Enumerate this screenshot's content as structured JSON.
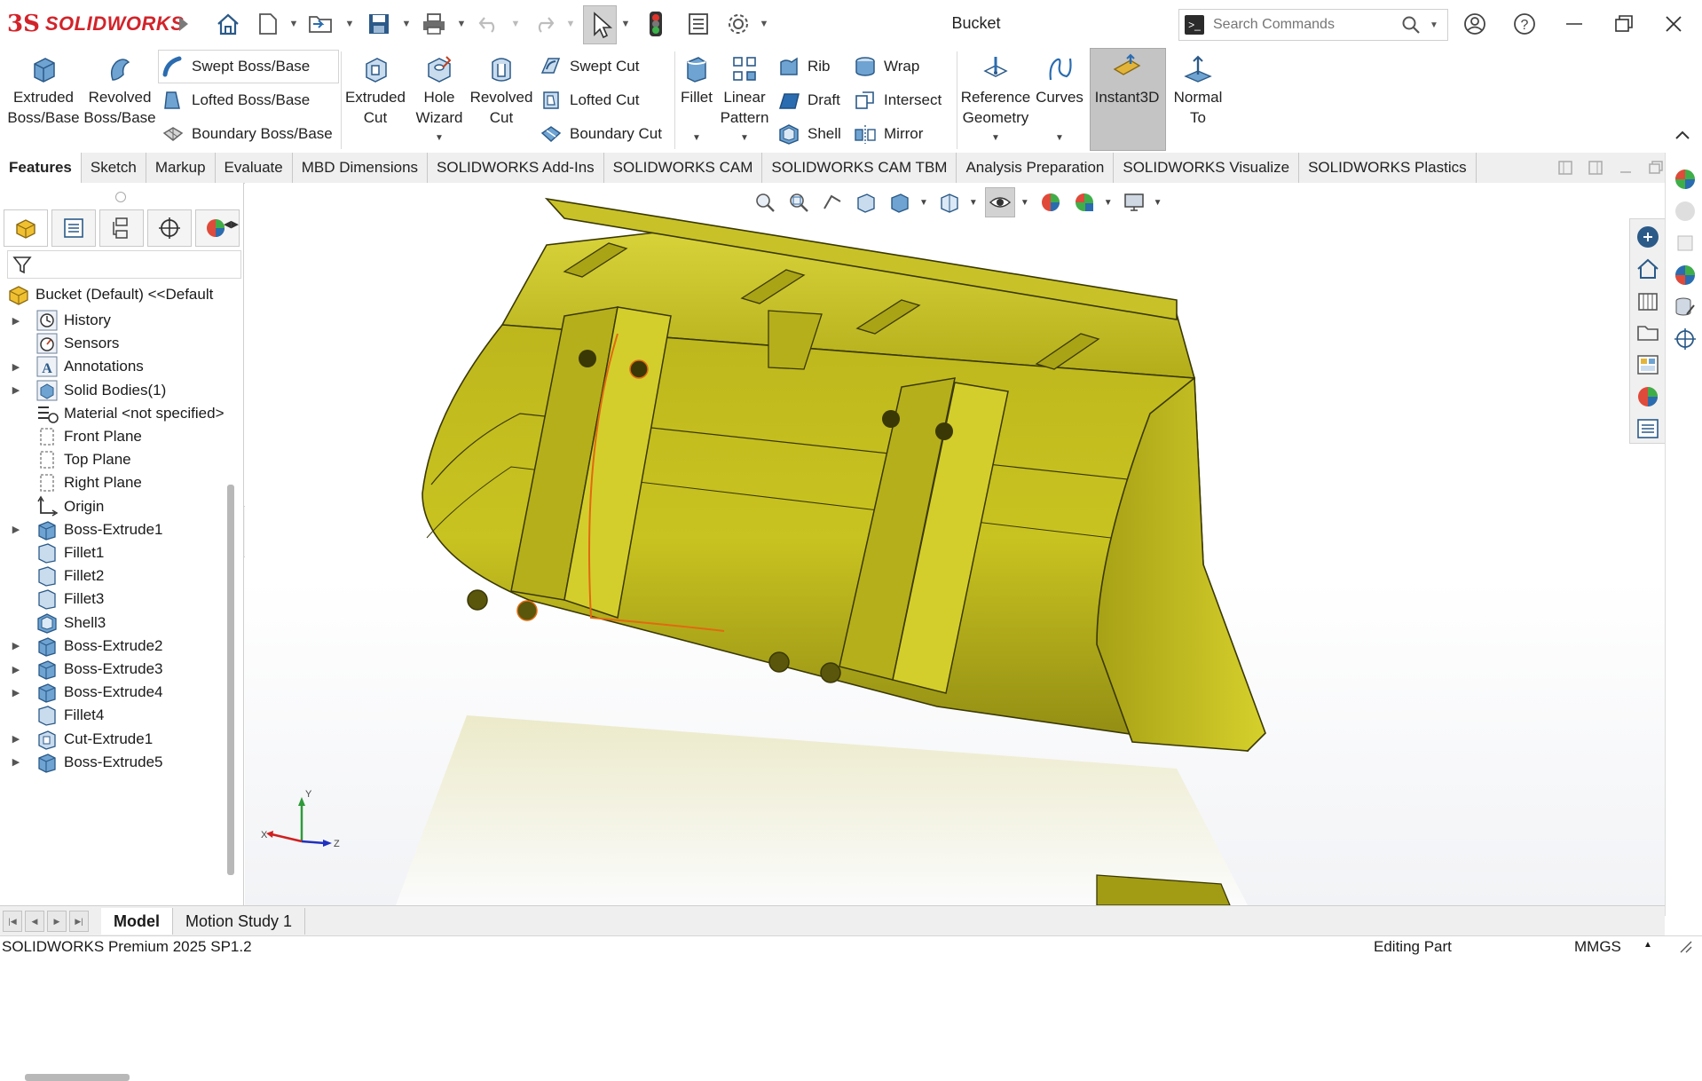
{
  "app": {
    "brand_prefix": "3S",
    "brand": "SOLIDWORKS",
    "doc_title": "Bucket"
  },
  "search": {
    "placeholder": "Search Commands"
  },
  "ribbon": {
    "extruded_boss": [
      "Extruded",
      "Boss/Base"
    ],
    "revolved_boss": [
      "Revolved",
      "Boss/Base"
    ],
    "swept_boss": "Swept Boss/Base",
    "lofted_boss": "Lofted Boss/Base",
    "boundary_boss": "Boundary Boss/Base",
    "extruded_cut": [
      "Extruded",
      "Cut"
    ],
    "hole_wizard": [
      "Hole",
      "Wizard"
    ],
    "revolved_cut": [
      "Revolved",
      "Cut"
    ],
    "swept_cut": "Swept Cut",
    "lofted_cut": "Lofted Cut",
    "boundary_cut": "Boundary Cut",
    "fillet": "Fillet",
    "linear_pattern": [
      "Linear",
      "Pattern"
    ],
    "rib": "Rib",
    "draft": "Draft",
    "shell": "Shell",
    "wrap": "Wrap",
    "intersect": "Intersect",
    "mirror": "Mirror",
    "reference_geometry": [
      "Reference",
      "Geometry"
    ],
    "curves": "Curves",
    "instant3d": "Instant3D",
    "normal_to": [
      "Normal",
      "To"
    ]
  },
  "tabs": [
    "Features",
    "Sketch",
    "Markup",
    "Evaluate",
    "MBD Dimensions",
    "SOLIDWORKS Add-Ins",
    "SOLIDWORKS CAM",
    "SOLIDWORKS CAM TBM",
    "Analysis Preparation",
    "SOLIDWORKS Visualize",
    "SOLIDWORKS Plastics"
  ],
  "tree": {
    "root": "Bucket (Default) <<Default",
    "items": [
      {
        "label": "History",
        "expand": true
      },
      {
        "label": "Sensors",
        "expand": false
      },
      {
        "label": "Annotations",
        "expand": true
      },
      {
        "label": "Solid Bodies(1)",
        "expand": true
      },
      {
        "label": "Material <not specified>",
        "expand": false
      },
      {
        "label": "Front Plane",
        "expand": false
      },
      {
        "label": "Top Plane",
        "expand": false
      },
      {
        "label": "Right Plane",
        "expand": false
      },
      {
        "label": "Origin",
        "expand": false
      },
      {
        "label": "Boss-Extrude1",
        "expand": true
      },
      {
        "label": "Fillet1",
        "expand": false
      },
      {
        "label": "Fillet2",
        "expand": false
      },
      {
        "label": "Fillet3",
        "expand": false
      },
      {
        "label": "Shell3",
        "expand": false
      },
      {
        "label": "Boss-Extrude2",
        "expand": true
      },
      {
        "label": "Boss-Extrude3",
        "expand": true
      },
      {
        "label": "Boss-Extrude4",
        "expand": true
      },
      {
        "label": "Fillet4",
        "expand": false
      },
      {
        "label": "Cut-Extrude1",
        "expand": true
      },
      {
        "label": "Boss-Extrude5",
        "expand": true
      }
    ]
  },
  "triad": {
    "y": "Y",
    "x": "X",
    "z": "Z"
  },
  "bottom_tabs": [
    "Model",
    "Motion Study 1"
  ],
  "status": {
    "product": "SOLIDWORKS Premium 2025 SP1.2",
    "mode": "Editing Part",
    "units": "MMGS"
  },
  "colors": {
    "part_yellow": "#c9c21e",
    "edge_orange": "#e06a10",
    "brand_red": "#d2232a",
    "accent_blue": "#2b6cb0"
  }
}
